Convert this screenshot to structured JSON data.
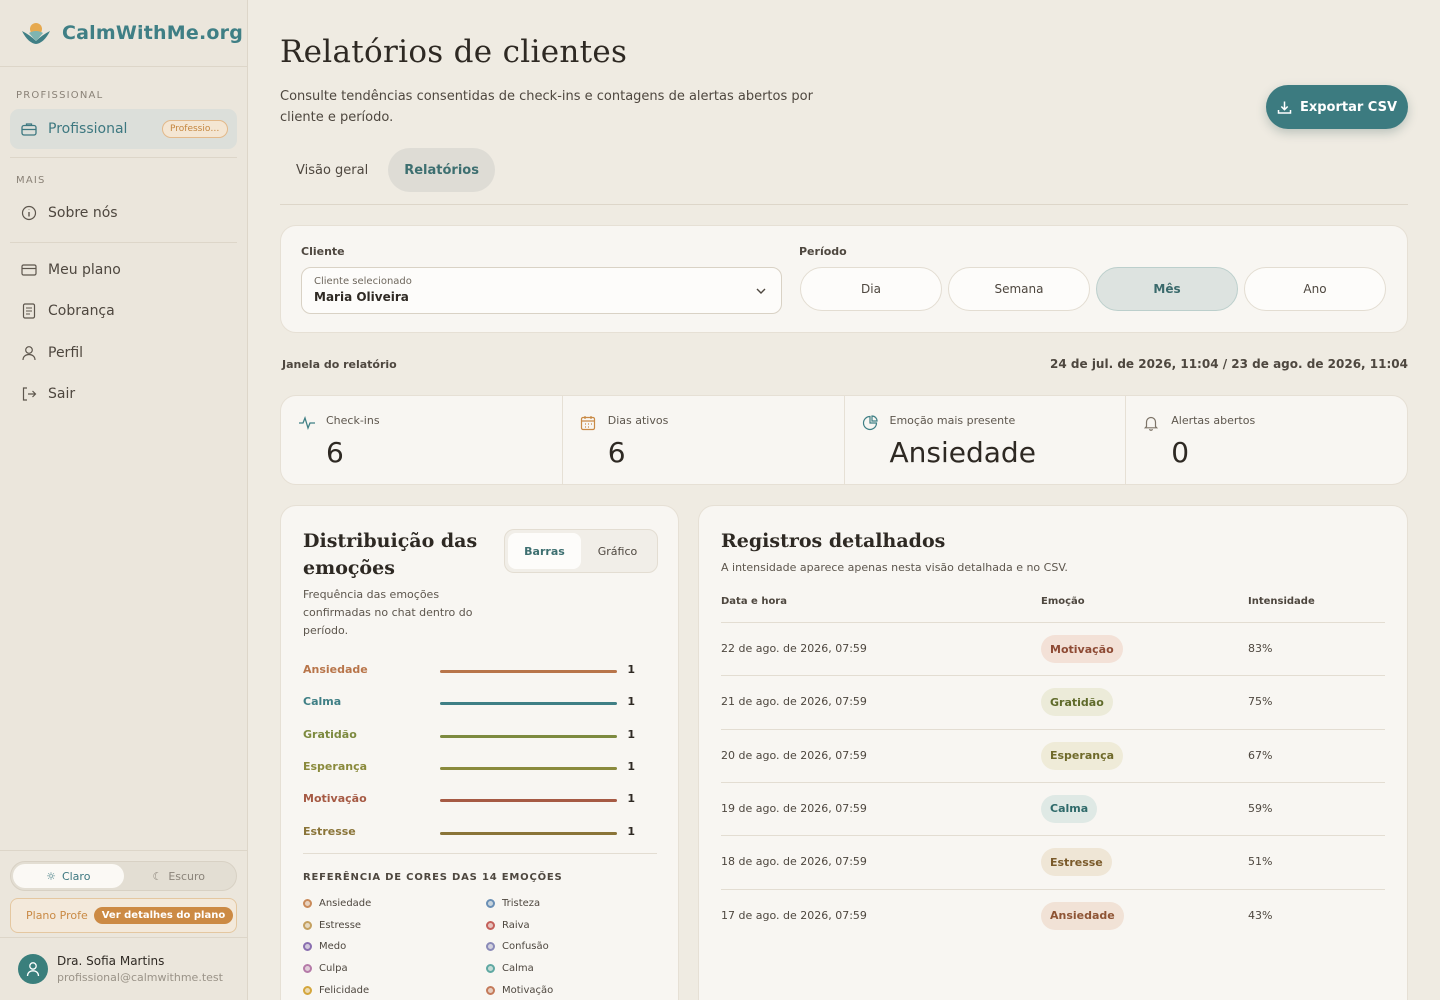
{
  "brand": {
    "name": "CalmWithMe.org",
    "logo_icon": "lotus-sun-icon"
  },
  "sidebar": {
    "section_professional": "PROFISSIONAL",
    "professional_item": {
      "label": "Profissional",
      "badge": "Professional",
      "icon": "briefcase-icon"
    },
    "section_more": "MAIS",
    "about_item": {
      "label": "Sobre nós",
      "icon": "info-icon"
    },
    "items": [
      {
        "label": "Meu plano",
        "icon": "card-icon"
      },
      {
        "label": "Cobrança",
        "icon": "receipt-icon"
      },
      {
        "label": "Perfil",
        "icon": "user-icon"
      },
      {
        "label": "Sair",
        "icon": "logout-icon"
      }
    ],
    "theme": {
      "light": "Claro",
      "dark": "Escuro"
    },
    "plan": {
      "name": "Plano Profe",
      "link": "Ver detalhes do plano"
    },
    "user": {
      "name": "Dra. Sofia Martins",
      "email": "profissional@calmwithme.test"
    }
  },
  "header": {
    "title": "Relatórios de clientes",
    "subtitle": "Consulte tendências consentidas de check-ins e contagens de alertas abertos por cliente e período.",
    "export_label": "Exportar CSV"
  },
  "tabs": [
    {
      "label": "Visão geral"
    },
    {
      "label": "Relatórios"
    }
  ],
  "filters": {
    "client_label": "Cliente",
    "client_caption": "Cliente selecionado",
    "client_value": "Maria Oliveira",
    "period_label": "Período",
    "periods": [
      "Dia",
      "Semana",
      "Mês",
      "Ano"
    ],
    "selected_period": "Mês"
  },
  "report_window": {
    "label": "Janela do relatório",
    "value": "24 de jul. de 2026, 11:04 / 23 de ago. de 2026, 11:04"
  },
  "stats": [
    {
      "label": "Check-ins",
      "value": "6",
      "icon": "activity-icon"
    },
    {
      "label": "Dias ativos",
      "value": "6",
      "icon": "calendar-icon"
    },
    {
      "label": "Emoção mais presente",
      "value": "Ansiedade",
      "icon": "pie-chart-icon"
    },
    {
      "label": "Alertas abertos",
      "value": "0",
      "icon": "bell-icon"
    }
  ],
  "distribution": {
    "title": "Distribuição das emoções",
    "subtitle": "Frequência das emoções confirmadas no chat dentro do período.",
    "toggle": {
      "bars": "Barras",
      "chart": "Gráfico"
    },
    "legend_title": "REFERÊNCIA DE CORES DAS 14 EMOÇÕES"
  },
  "chart_data": {
    "type": "bar",
    "categories": [
      "Ansiedade",
      "Calma",
      "Gratidão",
      "Esperança",
      "Motivação",
      "Estresse"
    ],
    "values": [
      1,
      1,
      1,
      1,
      1,
      1
    ],
    "colors": [
      "#b8754a",
      "#3f7f85",
      "#7d8a3f",
      "#8a8a3c",
      "#a65a44",
      "#8a7438"
    ],
    "xlim": [
      0,
      1
    ]
  },
  "legend": [
    {
      "name": "Ansiedade",
      "color": "#c98a5a"
    },
    {
      "name": "Tristeza",
      "color": "#6a8fb5"
    },
    {
      "name": "Estresse",
      "color": "#c4a060"
    },
    {
      "name": "Raiva",
      "color": "#c4605a"
    },
    {
      "name": "Medo",
      "color": "#8a6fb0"
    },
    {
      "name": "Confusão",
      "color": "#8a8ab8"
    },
    {
      "name": "Culpa",
      "color": "#b57aa8"
    },
    {
      "name": "Calma",
      "color": "#5fa8a2"
    },
    {
      "name": "Felicidade",
      "color": "#d4a63c"
    },
    {
      "name": "Motivação",
      "color": "#c47a5a"
    }
  ],
  "records": {
    "title": "Registros detalhados",
    "subtitle": "A intensidade aparece apenas nesta visão detalhada e no CSV.",
    "columns": [
      "Data e hora",
      "Emoção",
      "Intensidade"
    ],
    "rows": [
      {
        "date": "22 de ago. de 2026, 07:59",
        "emotion": "Motivação",
        "intensity": "83%",
        "bg": "#f3e1d7",
        "fg": "#8e4a34"
      },
      {
        "date": "21 de ago. de 2026, 07:59",
        "emotion": "Gratidão",
        "intensity": "75%",
        "bg": "#ecebd9",
        "fg": "#5f6a2a"
      },
      {
        "date": "20 de ago. de 2026, 07:59",
        "emotion": "Esperança",
        "intensity": "67%",
        "bg": "#efebd8",
        "fg": "#6f6a2a"
      },
      {
        "date": "19 de ago. de 2026, 07:59",
        "emotion": "Calma",
        "intensity": "59%",
        "bg": "#dfe9e5",
        "fg": "#2f6a6a"
      },
      {
        "date": "18 de ago. de 2026, 07:59",
        "emotion": "Estresse",
        "intensity": "51%",
        "bg": "#efe6d6",
        "fg": "#7a5a2a"
      },
      {
        "date": "17 de ago. de 2026, 07:59",
        "emotion": "Ansiedade",
        "intensity": "43%",
        "bg": "#f1e2d6",
        "fg": "#8e5434"
      }
    ]
  }
}
